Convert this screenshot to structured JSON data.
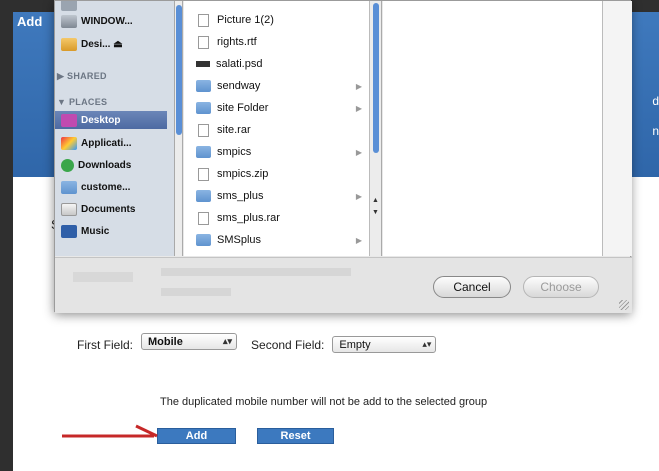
{
  "page": {
    "title": "Add",
    "side_fragment": "S",
    "first_field_label": "First Field:",
    "first_field_value": "Mobile",
    "second_field_label": "Second Field:",
    "second_field_value": "Empty",
    "note": "The duplicated mobile number will not be add to the selected group",
    "add_label": "Add",
    "reset_label": "Reset",
    "header_fragment_1": "d",
    "header_fragment_2": "n"
  },
  "dialog": {
    "sidebar": {
      "top_items": [
        {
          "label": "WINDOW...",
          "icon": "drive-icon"
        },
        {
          "label": "Desi... ⏏",
          "icon": "desktop-drive-icon"
        }
      ],
      "shared_header": "▶ SHARED",
      "places_header": "▼ PLACES",
      "places": [
        {
          "label": "Desktop",
          "icon": "desktop-icon",
          "selected": true
        },
        {
          "label": "Applicati...",
          "icon": "applications-icon"
        },
        {
          "label": "Downloads",
          "icon": "downloads-icon"
        },
        {
          "label": "custome...",
          "icon": "folder-icon"
        },
        {
          "label": "Documents",
          "icon": "documents-icon"
        },
        {
          "label": "Music",
          "icon": "music-icon"
        }
      ]
    },
    "files": [
      {
        "name": "Picture 1(2)",
        "kind": "doc",
        "folder": false
      },
      {
        "name": "rights.rtf",
        "kind": "doc",
        "folder": false
      },
      {
        "name": "salati.psd",
        "kind": "psd",
        "folder": false
      },
      {
        "name": "sendway",
        "kind": "folder",
        "folder": true
      },
      {
        "name": "site Folder",
        "kind": "folder",
        "folder": true
      },
      {
        "name": "site.rar",
        "kind": "doc",
        "folder": false
      },
      {
        "name": "smpics",
        "kind": "folder",
        "folder": true
      },
      {
        "name": "smpics.zip",
        "kind": "doc",
        "folder": false
      },
      {
        "name": "sms_plus",
        "kind": "folder",
        "folder": true
      },
      {
        "name": "sms_plus.rar",
        "kind": "doc",
        "folder": false
      },
      {
        "name": "SMSplus",
        "kind": "folder",
        "folder": true
      }
    ],
    "cancel_label": "Cancel",
    "choose_label": "Choose"
  },
  "colors": {
    "header_blue": "#3f79bd",
    "button_blue": "#3c79bf",
    "arrow_red": "#c62828",
    "selection": "#5a77ad"
  }
}
